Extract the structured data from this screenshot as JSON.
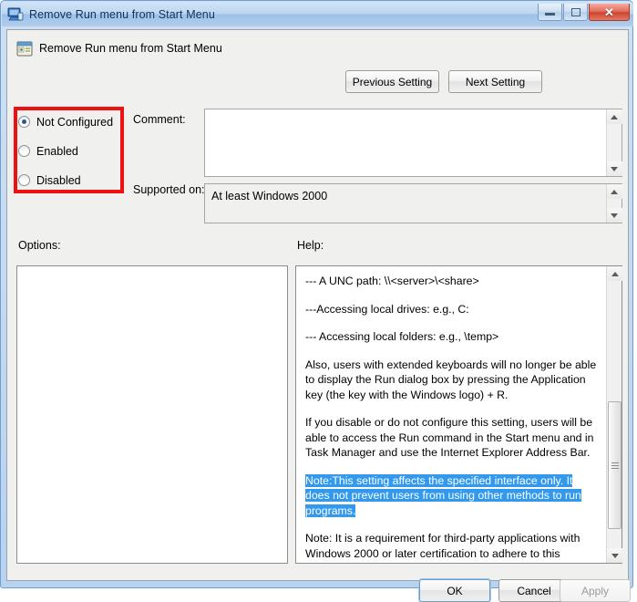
{
  "window": {
    "title": "Remove Run menu from Start Menu",
    "title_icon": "computer-icon",
    "controls": {
      "minimize": "minimize-icon",
      "maximize": "maximize-icon",
      "close": "close-icon",
      "close_glyph": "✕"
    }
  },
  "header": {
    "policy_icon": "policy-setting-icon",
    "policy_title": "Remove Run menu from Start Menu",
    "previous_setting_label": "Previous Setting",
    "next_setting_label": "Next Setting"
  },
  "state_options": {
    "items": [
      {
        "label": "Not Configured",
        "selected": true
      },
      {
        "label": "Enabled",
        "selected": false
      },
      {
        "label": "Disabled",
        "selected": false
      }
    ],
    "annotation_color": "#ee1111"
  },
  "comment": {
    "label": "Comment:",
    "value": "",
    "placeholder": ""
  },
  "supported_on": {
    "label": "Supported on:",
    "value": "At least Windows 2000"
  },
  "options": {
    "label": "Options:",
    "value": ""
  },
  "help": {
    "label": "Help:",
    "paragraphs": [
      {
        "text": "--- A UNC path: \\\\<server>\\<share>",
        "highlighted": false
      },
      {
        "text": "---Accessing local drives:  e.g., C:",
        "highlighted": false
      },
      {
        "text": "--- Accessing local folders: e.g., \\temp>",
        "highlighted": false
      },
      {
        "text": "Also, users with extended keyboards will no longer be able to display the Run dialog box by pressing the Application key (the key with the Windows logo) + R.",
        "highlighted": false
      },
      {
        "text": "If you disable or do not configure this setting, users will be able to access the Run command in the Start menu and in Task Manager and use the Internet Explorer Address Bar.",
        "highlighted": false
      },
      {
        "text": "Note:This setting affects the specified interface only. It does not prevent users from using other methods to run programs.",
        "highlighted": true
      },
      {
        "text": "Note: It is a requirement for third-party applications with Windows 2000 or later certification to adhere to this setting.",
        "highlighted": false
      }
    ],
    "selection_color": "#3399ef"
  },
  "footer": {
    "ok_label": "OK",
    "cancel_label": "Cancel",
    "apply_label": "Apply",
    "apply_disabled": true
  }
}
